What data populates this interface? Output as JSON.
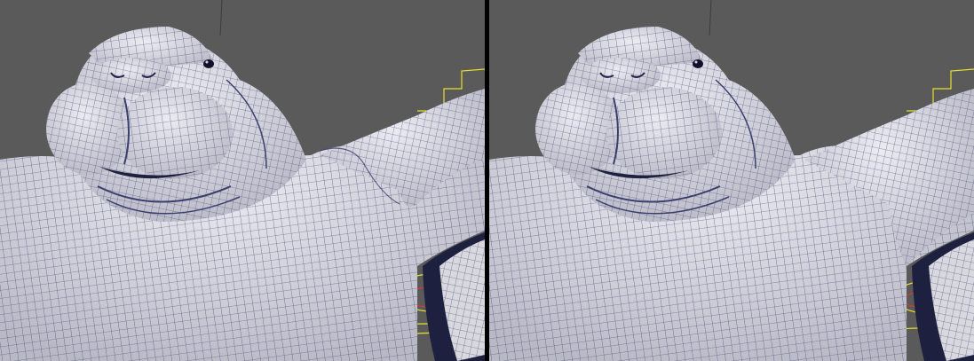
{
  "app": {
    "viewports": [
      {
        "id": "left",
        "view": "perspective-before"
      },
      {
        "id": "right",
        "view": "perspective-after"
      }
    ]
  },
  "colors": {
    "background": "#5a5a5a",
    "divider": "#000000",
    "mesh_fill": "#d8d8de",
    "wire": "#3a3f6e",
    "rig_yellow": "#e6e02a",
    "rig_red": "#d33a3a"
  }
}
